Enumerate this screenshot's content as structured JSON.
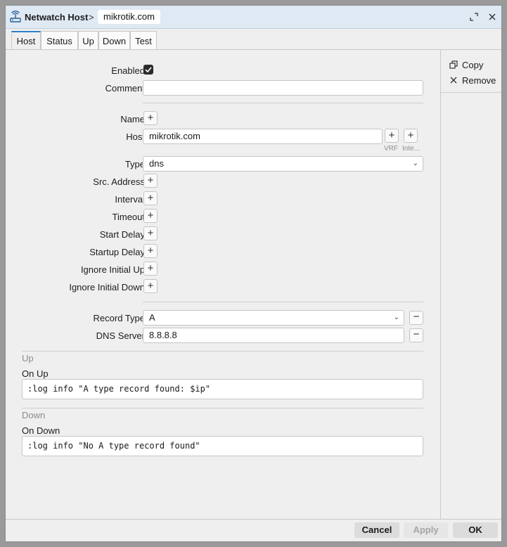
{
  "titlebar": {
    "title": "Netwatch Host",
    "separator": ">",
    "item": "mikrotik.com"
  },
  "tabs": [
    {
      "label": "Host",
      "active": true
    },
    {
      "label": "Status",
      "active": false
    },
    {
      "label": "Up",
      "active": false
    },
    {
      "label": "Down",
      "active": false
    },
    {
      "label": "Test",
      "active": false
    }
  ],
  "sidebar": {
    "copy_label": "Copy",
    "remove_label": "Remove"
  },
  "form": {
    "enabled_label": "Enabled",
    "enabled_checked": true,
    "comment_label": "Comment",
    "comment_value": "",
    "name_label": "Name",
    "host_label": "Host",
    "host_value": "mikrotik.com",
    "vrf_label": "VRF",
    "inte_label": "Inte...",
    "type_label": "Type",
    "type_value": "dns",
    "src_address_label": "Src. Address",
    "interval_label": "Interval",
    "timeout_label": "Timeout",
    "start_delay_label": "Start Delay",
    "startup_delay_label": "Startup Delay",
    "ignore_initial_up_label": "Ignore Initial Up",
    "ignore_initial_down_label": "Ignore Initial Down",
    "record_type_label": "Record Type",
    "record_type_value": "A",
    "dns_server_label": "DNS Server",
    "dns_server_value": "8.8.8.8"
  },
  "up_section": {
    "title": "Up",
    "on_up_label": "On Up",
    "on_up_value": ":log info \"A type record found: $ip\""
  },
  "down_section": {
    "title": "Down",
    "on_down_label": "On Down",
    "on_down_value": ":log info \"No A type record found\""
  },
  "footer": {
    "cancel_label": "Cancel",
    "apply_label": "Apply",
    "ok_label": "OK"
  },
  "colors": {
    "accent": "#2f7fc9",
    "titlebar_bg": "#dfe9f4",
    "window_bg": "#efefef",
    "button_bg": "#dcdcdc"
  }
}
